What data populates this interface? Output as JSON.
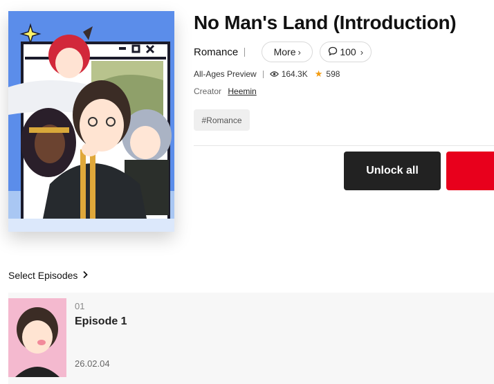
{
  "series": {
    "title": "No Man's Land (Introduction)",
    "genre": "Romance",
    "more_label": "More",
    "comment_count": "100",
    "age_rating": "All-Ages Preview",
    "views": "164.3K",
    "rating": "598",
    "creator_label": "Creator",
    "creator_name": "Heemin",
    "tag": "#Romance"
  },
  "actions": {
    "unlock_all_label": "Unlock all"
  },
  "episodes_section": {
    "label": "Select Episodes"
  },
  "episodes": [
    {
      "number": "01",
      "title": "Episode 1",
      "date": "26.02.04"
    }
  ],
  "colors": {
    "primary_button": "#222222",
    "accent_red": "#e8001c",
    "star": "#f39c12",
    "cover_bg": "#5b8dea",
    "thumb_bg": "#f4b9cf"
  },
  "icons": {
    "comment": "speech-bubble-icon",
    "views": "eye-icon",
    "rating": "star-icon",
    "chevron": "chevron-right-icon"
  }
}
